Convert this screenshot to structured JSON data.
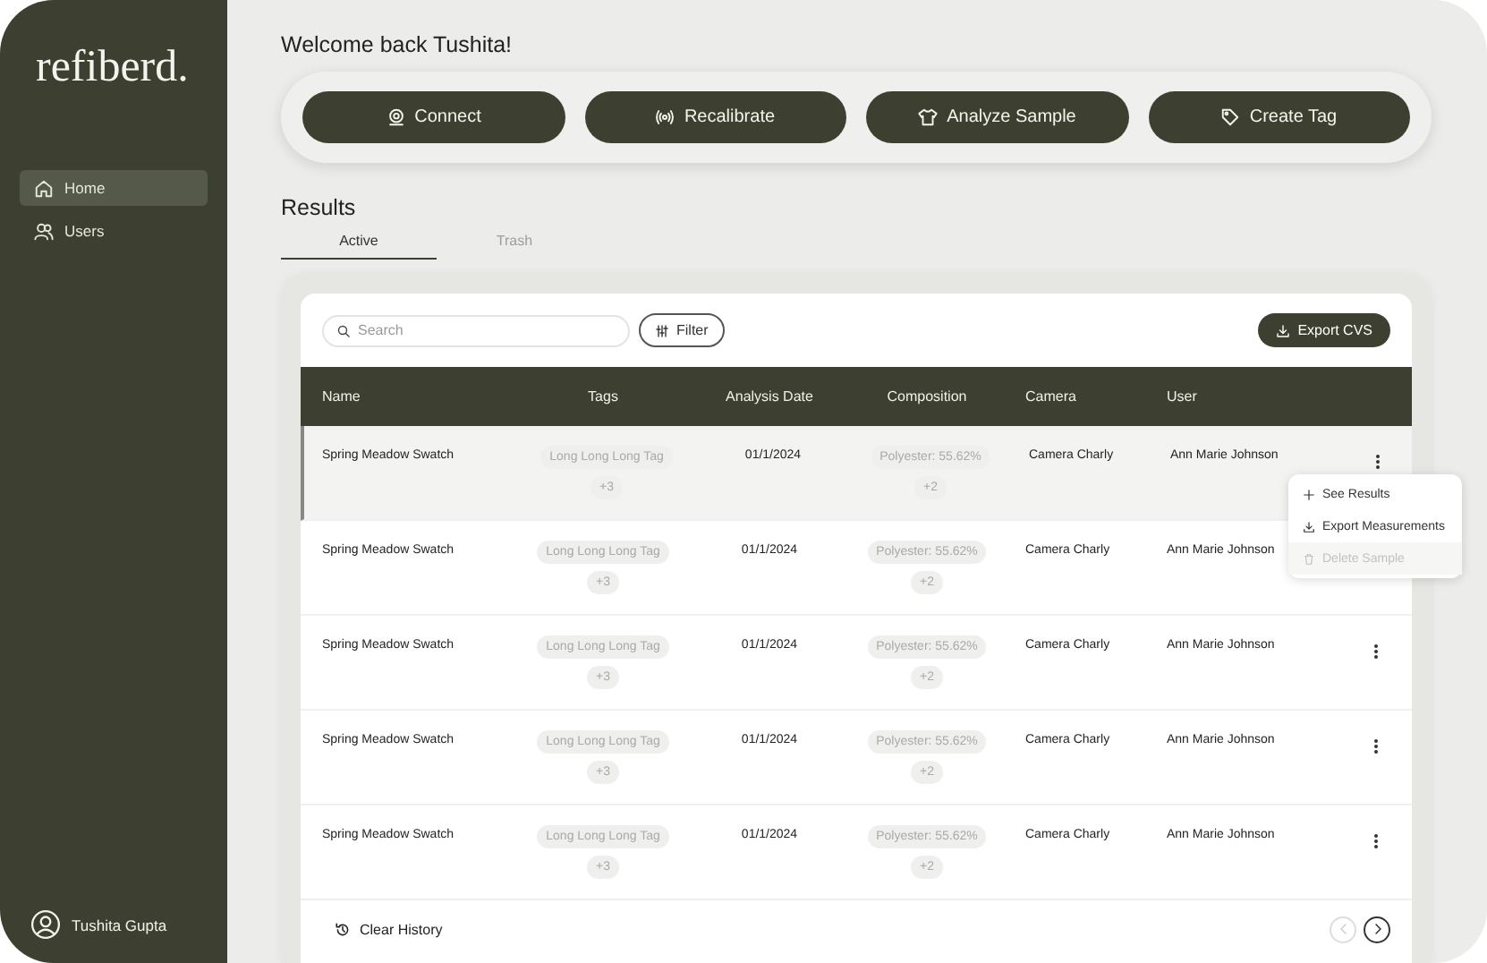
{
  "sidebar": {
    "logo": "refiberd.",
    "items": [
      {
        "label": "Home",
        "selected": true
      },
      {
        "label": "Users",
        "selected": false
      }
    ],
    "user": "Tushita Gupta"
  },
  "greeting": "Welcome back Tushita!",
  "actions": [
    "Connect",
    "Recalibrate",
    "Analyze Sample",
    "Create Tag"
  ],
  "results": {
    "title": "Results",
    "tabs": [
      {
        "label": "Active",
        "selected": true
      },
      {
        "label": "Trash",
        "selected": false
      }
    ],
    "search": {
      "placeholder": "Search"
    },
    "filter": "Filter",
    "export": "Export CVS",
    "columns": [
      "Name",
      "Tags",
      "Analysis Date",
      "Composition",
      "Camera",
      "User"
    ],
    "rows": [
      {
        "name": "Spring Meadow Swatch",
        "tag": "Long Long Long Tag",
        "tag_more": "+3",
        "date": "01/1/2024",
        "composition": "Polyester: 55.62%",
        "composition_more": "+2",
        "camera": "Camera Charly",
        "user": "Ann Marie Johnson",
        "selected": true,
        "menu_open": true
      },
      {
        "name": "Spring Meadow Swatch",
        "tag": "Long Long Long Tag",
        "tag_more": "+3",
        "date": "01/1/2024",
        "composition": "Polyester: 55.62%",
        "composition_more": "+2",
        "camera": "Camera Charly",
        "user": "Ann Marie Johnson",
        "selected": false
      },
      {
        "name": "Spring Meadow Swatch",
        "tag": "Long Long Long Tag",
        "tag_more": "+3",
        "date": "01/1/2024",
        "composition": "Polyester: 55.62%",
        "composition_more": "+2",
        "camera": "Camera Charly",
        "user": "Ann Marie Johnson",
        "selected": false
      },
      {
        "name": "Spring Meadow Swatch",
        "tag": "Long Long Long Tag",
        "tag_more": "+3",
        "date": "01/1/2024",
        "composition": "Polyester: 55.62%",
        "composition_more": "+2",
        "camera": "Camera Charly",
        "user": "Ann Marie Johnson",
        "selected": false
      },
      {
        "name": "Spring Meadow Swatch",
        "tag": "Long Long Long Tag",
        "tag_more": "+3",
        "date": "01/1/2024",
        "composition": "Polyester: 55.62%",
        "composition_more": "+2",
        "camera": "Camera Charly",
        "user": "Ann Marie Johnson",
        "selected": false
      }
    ],
    "menu": [
      {
        "label": "See Results",
        "disabled": false
      },
      {
        "label": "Export Measurements",
        "disabled": false
      },
      {
        "label": "Delete Sample",
        "disabled": true
      }
    ],
    "clear_history": "Clear History",
    "pagination": {
      "prev_disabled": true,
      "next_disabled": false
    }
  }
}
